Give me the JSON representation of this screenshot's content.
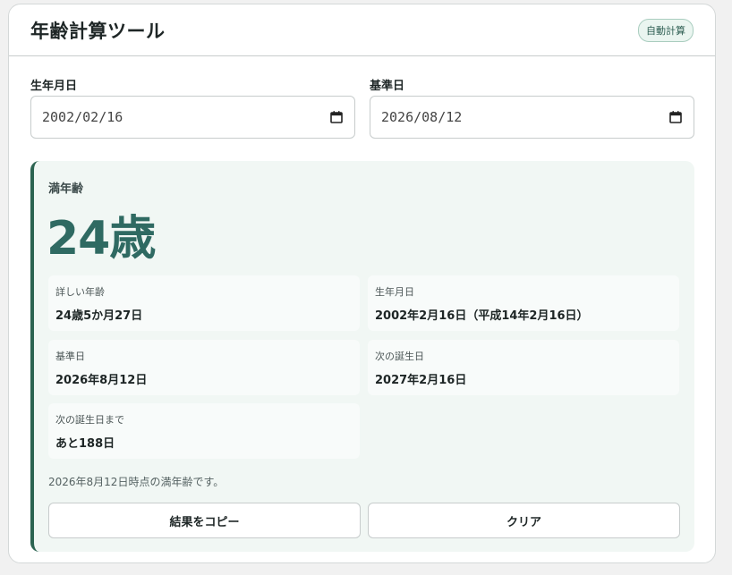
{
  "header": {
    "title": "年齢計算ツール",
    "badge": "自動計算"
  },
  "form": {
    "birth_label": "生年月日",
    "birth_value": "2002/02/16",
    "base_label": "基準日",
    "base_value": "2026/08/12"
  },
  "result": {
    "label": "満年齢",
    "age": "24歳",
    "tiles": [
      {
        "label": "詳しい年齢",
        "value": "24歳5か月27日"
      },
      {
        "label": "生年月日",
        "value": "2002年2月16日（平成14年2月16日）"
      },
      {
        "label": "基準日",
        "value": "2026年8月12日"
      },
      {
        "label": "次の誕生日",
        "value": "2027年2月16日"
      },
      {
        "label": "次の誕生日まで",
        "value": "あと188日"
      }
    ],
    "note": "2026年8月12日時点の満年齢です。",
    "copy_button": "結果をコピー",
    "clear_button": "クリア"
  },
  "colors": {
    "accent": "#2c6451",
    "age_text": "#2f6a62",
    "panel_bg": "#f1f7f4"
  }
}
